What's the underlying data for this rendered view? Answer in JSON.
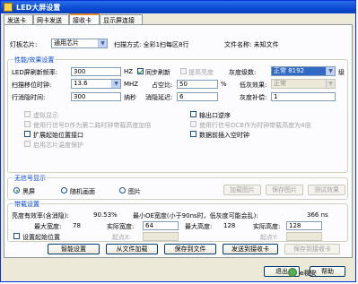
{
  "window": {
    "title": "LED大屏设置"
  },
  "tabs": [
    {
      "label": "发送卡"
    },
    {
      "label": "网卡发送"
    },
    {
      "label": "接收卡"
    },
    {
      "label": "显示屏连接"
    }
  ],
  "top": {
    "chip_label": "灯板芯片:",
    "chip_value": "通用芯片",
    "scan_label": "扫描方式: 全彩1扫每区8行",
    "file_label": "文件名称: 未知文件"
  },
  "performance": {
    "legend": "性能/效果设置",
    "refresh_label": "LED屏刷新频率:",
    "refresh_value": "300",
    "refresh_unit": "HZ",
    "sync_refresh": "同步刷新",
    "raise_brightness": "提高亮度",
    "gray_label": "灰度级数:",
    "gray_value": "正常 8192",
    "gray_suffix": "级",
    "shift_clock_label": "扫描移位时钟:",
    "shift_clock_value": "13.6",
    "shift_clock_unit": "MHZ",
    "duty_label": "占空比:",
    "duty_value": "50",
    "duty_unit": "%",
    "low_gray_label": "低灰效果:",
    "low_gray_value": "正常",
    "row_blank_label": "行消隐时间:",
    "row_blank_value": "300",
    "row_blank_unit": "纳秒",
    "blank_delay_label": "消隐延迟:",
    "blank_delay_value": "6",
    "gray_comp_label": "灰度补偿:",
    "gray_comp_value": "1",
    "checks": {
      "virtual_display": "虚拟显示",
      "output_reverse": "输出口逆序",
      "signal_2x_half": "使用行信号D作为第二路时钟带载高度加倍",
      "signal_dcb_4x": "使用行信号DCB作为时钟带载高度为4倍",
      "extend_start": "扩展起始位置接口",
      "insert_empty_clock": "数据前插入空时钟",
      "chip_temp_protect": "启用芯片温度保护"
    }
  },
  "no_signal": {
    "legend": "无信号显示",
    "opt_black": "黑屏",
    "opt_random": "随机画面",
    "opt_picture": "图片",
    "load_picture": "加载图片",
    "save_picture": "保存图片",
    "test_effect": "测试效果"
  },
  "capacity": {
    "legend": "带载设置",
    "brightness_eff_label": "亮度有效率(含消隐):",
    "brightness_eff_value": "90.53%",
    "min_oe_label": "最小OE宽度(小于90ns时，低灰度可能会乱):",
    "min_oe_value": "366 ns",
    "max_width_label": "最大宽度:",
    "max_width_value": "78",
    "actual_width_label": "实际宽度:",
    "actual_width_value": "64",
    "max_height_label": "最大高度:",
    "max_height_value": "128",
    "actual_height_label": "实际高度:",
    "actual_height_value": "128",
    "set_start": "设置起始位置",
    "start_x_label": "起点X:",
    "start_y_label": "起点Y:"
  },
  "actions": {
    "smart_setup": "智能设置",
    "load_from_file": "从文件加载",
    "save_to_file": "保存到文件",
    "send_to_receiver": "发送到接收卡",
    "save_to_receiver": "保存到接收卡",
    "exit": "退出",
    "help": "帮助"
  },
  "watermark": {
    "text": "e视安"
  }
}
